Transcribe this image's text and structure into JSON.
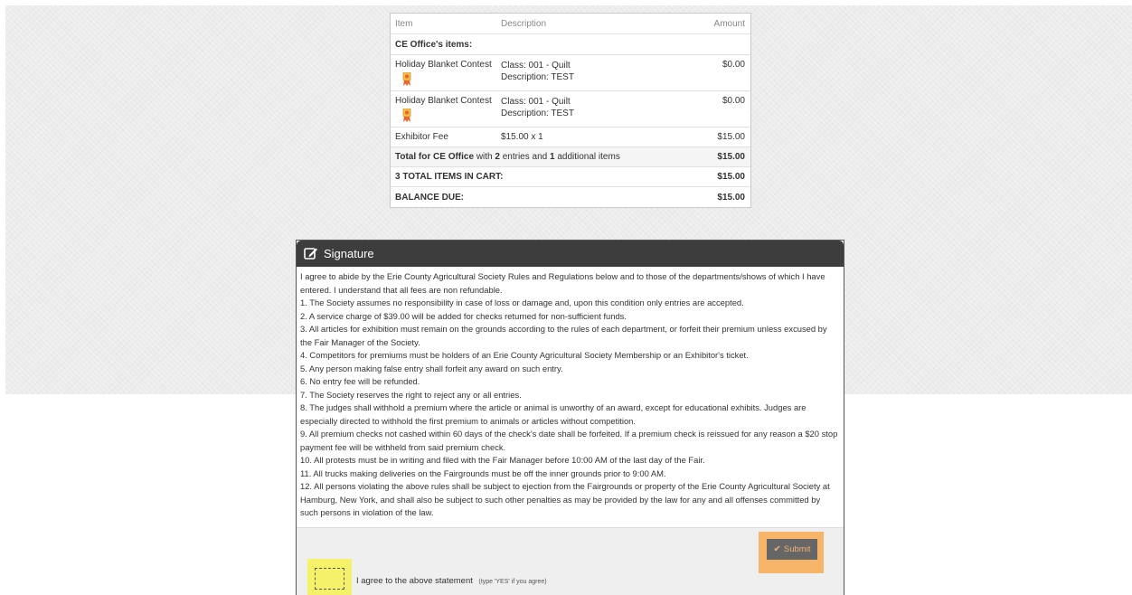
{
  "cart": {
    "headers": {
      "item": "Item",
      "description": "Description",
      "amount": "Amount"
    },
    "group_label": "CE Office's items:",
    "entries": [
      {
        "item": "Holiday Blanket Contest",
        "class": "Class: 001 - Quilt",
        "description": "Description: TEST",
        "amount": "$0.00",
        "icon": "ribbon-award-icon"
      },
      {
        "item": "Holiday Blanket Contest",
        "class": "Class: 001 - Quilt",
        "description": "Description: TEST",
        "amount": "$0.00",
        "icon": "ribbon-award-icon"
      }
    ],
    "fee": {
      "item": "Exhibitor Fee",
      "description": "$15.00 x 1",
      "amount": "$15.00"
    },
    "total": {
      "prefix": "Total for CE Office",
      "with": " with ",
      "entries_count": "2",
      "entries_text": " entries and ",
      "additional_count": "1",
      "additional_text": " additional items",
      "amount": "$15.00"
    },
    "items_in_cart": {
      "label": "3 TOTAL ITEMS IN CART:",
      "amount": "$15.00"
    },
    "balance_due": {
      "label": "BALANCE DUE:",
      "amount": "$15.00"
    }
  },
  "signature": {
    "title": "Signature",
    "paragraphs": [
      "I agree to abide by the Erie County Agricultural Society Rules and Regulations below and to those of the departments/shows of which I have entered. I understand that all fees are non refundable.",
      "1. The Society assumes no responsibility in case of loss or damage and, upon this condition only entries are accepted.",
      "2. A service charge of $39.00 will be added for checks returned for non-sufficient funds.",
      "3. All articles for exhibition must remain on the grounds according to the rules of each department, or forfeit their premium unless excused by the Fair Manager of the Society.",
      "4. Competitors for premiums must be holders of an Erie County Agricultural Society Membership or an Exhibitor's ticket.",
      "5. Any person making false entry shall forfeit any award on such entry.",
      "6. No entry fee will be refunded.",
      "7. The Society reserves the right to reject any or all entries.",
      "8. The judges shall withhold a premium where the article or animal is unworthy of an award, except for educational exhibits. Judges are especially directed to withhold the first premium to animals or articles without competition.",
      "9. All premium checks not cashed within 60 days of the check's date shall be forfeited. If a premium check is reissued for any reason a $20 stop payment fee will be withheld from said premium check.",
      "10. All protests must be in writing and filed with the Fair Manager before 10:00 AM of the last day of the Fair.",
      "11. All trucks making deliveries on the Fairgrounds must be off the inner grounds prior to 9:00 AM.",
      "12. All persons violating the above rules shall be subject to ejection from the Fairgrounds or property of the Erie County Agricultural Society at Hamburg, New York, and shall also be subject to such other penalties as may be provided by the law for any and all offenses committed by such persons in violation of the law."
    ],
    "submit_label": "Submit",
    "agree_label": "I agree to the above statement",
    "agree_hint": "(type 'YES' if you agree)",
    "agree_value": ""
  },
  "colors": {
    "header_bg": "#3d3d3d",
    "submit_bg": "#666666",
    "submit_text": "#f0b27a",
    "submit_highlight": "#f7b56a",
    "agree_highlight": "#f5f26a"
  }
}
